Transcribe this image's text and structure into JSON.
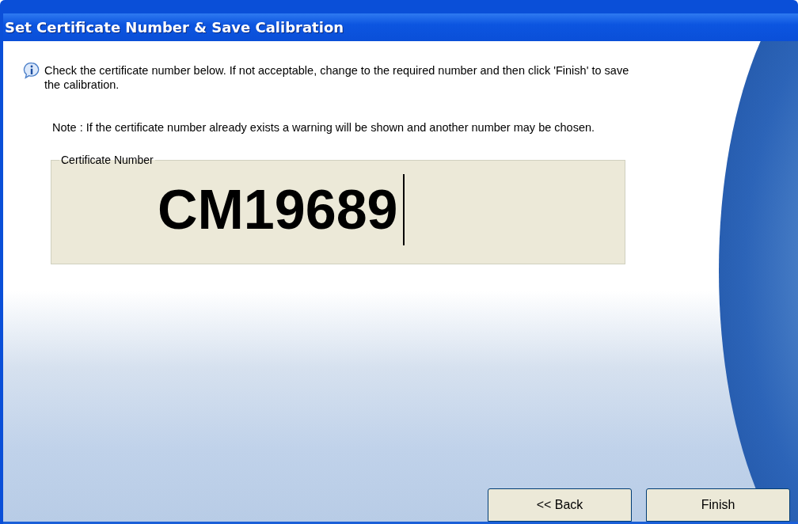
{
  "window": {
    "title": "Set Certificate Number & Save Calibration"
  },
  "instructions": "Check the certificate number below. If not acceptable, change to the required number and then click 'Finish' to save the calibration.",
  "note": "Note :  If the certificate number already exists a warning will be shown and another number may be chosen.",
  "certificate_group": {
    "label": "Certificate Number",
    "value": "CM19689",
    "focused": true
  },
  "buttons": [
    {
      "label": "<< Back"
    },
    {
      "label": "Finish"
    }
  ]
}
